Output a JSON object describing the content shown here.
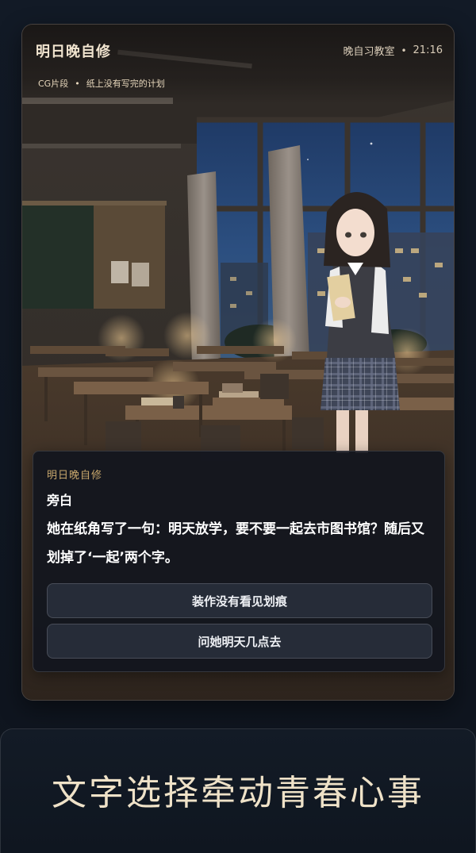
{
  "header": {
    "title": "明日晚自修",
    "location": "晚自习教室",
    "separator": "•",
    "time": "21:16",
    "scene_tag": "CG片段",
    "scene_sep": "•",
    "scene_title": "纸上没有写完的计划"
  },
  "dialog": {
    "game_name": "明日晚自修",
    "speaker": "旁白",
    "text": "她在纸角写了一句：明天放学，要不要一起去市图书馆？随后又划掉了‘一起’两个字。"
  },
  "choices": [
    {
      "label": "装作没有看见划痕"
    },
    {
      "label": "问她明天几点去"
    }
  ],
  "caption": {
    "text": "文字选择牵动青春心事"
  },
  "colors": {
    "accent": "#c9a86d",
    "caption": "#efe2c8",
    "background": "#111823"
  }
}
